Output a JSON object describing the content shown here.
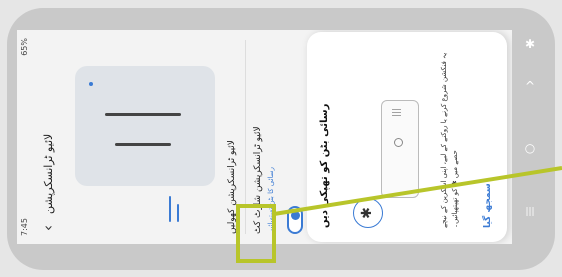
{
  "status": {
    "time": "7:45",
    "battery": "65%"
  },
  "header": {
    "title": "لائیو ٹرانسکرپشن"
  },
  "settings": {
    "row1_title": "لائیو ٹرانسکرپشن کھولیں",
    "row2_title": "لائیو ٹرانسکرپشن شارٹ کٹ",
    "row2_sub": "رسائی کا بٹن تھپتھپائیں"
  },
  "dialog": {
    "title": "رسائی بٹن کو تھپکی دیں",
    "body": "یہ فنکشن شروع کرنے یا روکنے کے لیے، اپنی اسکرین کے نیچے حصے میں ✱ کو تھپتھپائیں۔",
    "button": "سمجھ گیا",
    "accessibility_icon": "✱"
  },
  "nav": {
    "accessibility_glyph": "✱",
    "back_glyph": "^",
    "home_glyph": "○",
    "recents_glyph": "|||"
  },
  "colors": {
    "accent": "#3b7bd4",
    "highlight": "#b8c52a"
  }
}
